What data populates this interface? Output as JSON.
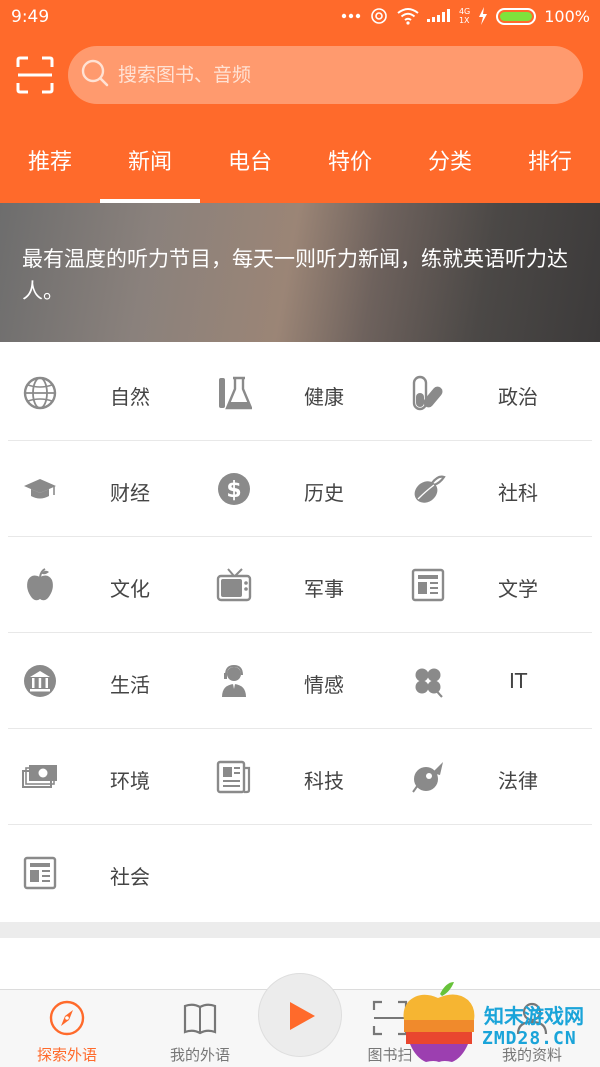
{
  "status_bar": {
    "time": "9:49",
    "network": "4G",
    "network_sub": "1X",
    "battery_text": "100%",
    "battery_level": 1.0
  },
  "search": {
    "placeholder": "搜索图书、音频"
  },
  "tabs": [
    {
      "label": "推荐",
      "active": false
    },
    {
      "label": "新闻",
      "active": true
    },
    {
      "label": "电台",
      "active": false
    },
    {
      "label": "特价",
      "active": false
    },
    {
      "label": "分类",
      "active": false
    },
    {
      "label": "排行",
      "active": false
    }
  ],
  "banner": {
    "text": "最有温度的听力节目，每天一则听力新闻，练就英语听力达人。"
  },
  "categories": [
    [
      {
        "label": "自然",
        "icon": "globe-icon"
      },
      {
        "label": "健康",
        "icon": "flask-icon"
      },
      {
        "label": "政治",
        "icon": "pill-icon"
      }
    ],
    [
      {
        "label": "财经",
        "icon": "graduation-cap-icon"
      },
      {
        "label": "历史",
        "icon": "dollar-coin-icon"
      },
      {
        "label": "社科",
        "icon": "leaf-icon"
      }
    ],
    [
      {
        "label": "文化",
        "icon": "apple-icon"
      },
      {
        "label": "军事",
        "icon": "tv-icon"
      },
      {
        "label": "文学",
        "icon": "newspaper-icon"
      }
    ],
    [
      {
        "label": "生活",
        "icon": "bank-icon"
      },
      {
        "label": "情感",
        "icon": "support-agent-icon"
      },
      {
        "label": "IT",
        "icon": "clover-icon"
      }
    ],
    [
      {
        "label": "环境",
        "icon": "money-icon"
      },
      {
        "label": "科技",
        "icon": "news-icon"
      },
      {
        "label": "法律",
        "icon": "rocket-icon"
      }
    ],
    [
      {
        "label": "社会",
        "icon": "newspaper-icon"
      }
    ]
  ],
  "bottom_nav": [
    {
      "label": "探索外语",
      "icon": "compass-icon",
      "active": true
    },
    {
      "label": "我的外语",
      "icon": "book-icon",
      "active": false
    },
    {
      "label": "图书扫",
      "icon": "scan-icon",
      "active": false
    },
    {
      "label": "我的资料",
      "icon": "user-icon",
      "active": false
    }
  ],
  "watermark": {
    "line1": "知末游戏网",
    "line2": "ZMD28.CN"
  },
  "colors": {
    "brand": "#ff6a2b",
    "icon_gray": "#8a8a8a",
    "battery_green": "#7ee23c",
    "watermark_blue": "#1aa4d9"
  }
}
